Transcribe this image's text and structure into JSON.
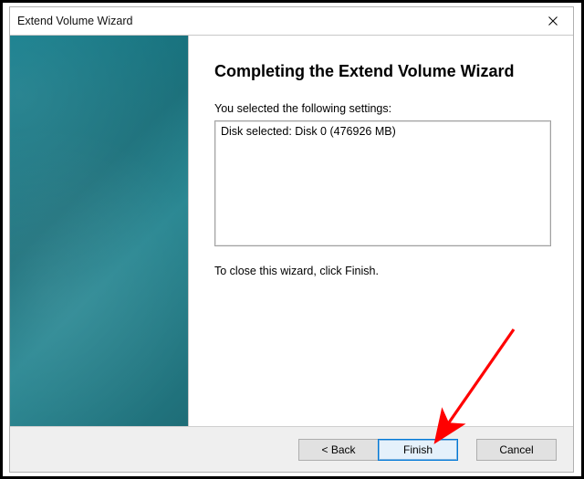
{
  "window": {
    "title": "Extend Volume Wizard"
  },
  "content": {
    "heading": "Completing the Extend Volume Wizard",
    "lead": "You selected the following settings:",
    "settings": "Disk selected: Disk 0 (476926 MB)",
    "hint": "To close this wizard, click Finish."
  },
  "buttons": {
    "back": "< Back",
    "finish": "Finish",
    "cancel": "Cancel"
  },
  "colors": {
    "accent": "#0078d7",
    "arrow": "#ff0000"
  }
}
